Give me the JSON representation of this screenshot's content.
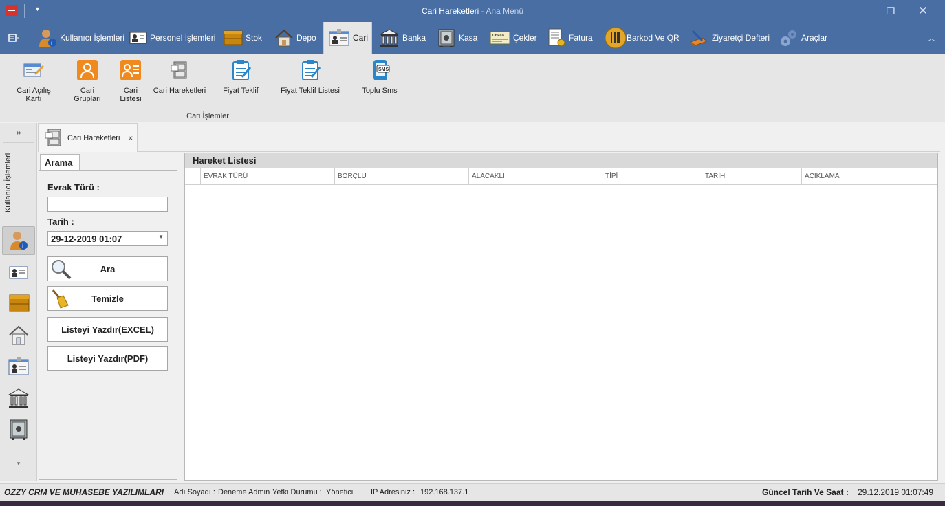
{
  "window": {
    "title": "Cari Hareketleri",
    "title_suffix": " - Ana Menü",
    "controls": [
      "minimize",
      "restore",
      "close"
    ]
  },
  "ribbon_tabs": [
    {
      "label": "Kullanıcı İşlemleri",
      "icon": "user-info-icon"
    },
    {
      "label": "Personel İşlemleri",
      "icon": "id-card-icon"
    },
    {
      "label": "Stok",
      "icon": "stock-box-icon"
    },
    {
      "label": "Depo",
      "icon": "house-icon"
    },
    {
      "label": "Cari",
      "icon": "cari-card-icon",
      "active": true
    },
    {
      "label": "Banka",
      "icon": "bank-icon"
    },
    {
      "label": "Kasa",
      "icon": "safe-icon"
    },
    {
      "label": "Çekler",
      "icon": "check-icon"
    },
    {
      "label": "Fatura",
      "icon": "invoice-icon"
    },
    {
      "label": "Barkod Ve QR",
      "icon": "barcode-icon"
    },
    {
      "label": "Ziyaretçi Defteri",
      "icon": "guestbook-icon"
    },
    {
      "label": "Araçlar",
      "icon": "gears-icon"
    }
  ],
  "ribbon_buttons": [
    {
      "label": "Cari Açılış Kartı",
      "icon": "card-edit-icon"
    },
    {
      "label": "Cari Grupları",
      "icon": "user-group-icon"
    },
    {
      "label": "Cari Listesi",
      "icon": "user-list-icon"
    },
    {
      "label": "Cari Hareketleri",
      "icon": "cabinet-icon"
    },
    {
      "label": "Fiyat Teklif",
      "icon": "clipboard-edit-icon"
    },
    {
      "label": "Fiyat Teklif Listesi",
      "icon": "clipboard-list-icon"
    },
    {
      "label": "Toplu Sms",
      "icon": "sms-phone-icon"
    }
  ],
  "ribbon_group_label": "Cari İşlemler",
  "leftnav": {
    "label": "Kullanıcı İşlemleri",
    "expand": "»",
    "more": "▾"
  },
  "document_tab": {
    "label": "Cari Hareketleri",
    "close": "×"
  },
  "search": {
    "tab_label": "Arama",
    "evrak_turu_label": "Evrak Türü :",
    "evrak_turu_value": "",
    "tarih_label": "Tarih :",
    "tarih_value": "29-12-2019 01:07",
    "buttons": {
      "ara": "Ara",
      "temizle": "Temizle",
      "excel": "Listeyi Yazdır(EXCEL)",
      "pdf": "Listeyi Yazdır(PDF)"
    }
  },
  "grid": {
    "title": "Hareket Listesi",
    "columns": [
      "EVRAK TÜRÜ",
      "BORÇLU",
      "ALACAKLI",
      "TİPİ",
      "TARİH",
      "AÇIKLAMA"
    ],
    "rows": []
  },
  "statusbar": {
    "brand": "OZZY CRM VE MUHASEBE YAZILIMLARI",
    "name_label": "Adı Soyadı :",
    "name_value": "Deneme Admin",
    "role_label": "Yetki Durumu :",
    "role_value": "Yönetici",
    "ip_label": "IP Adresiniz :",
    "ip_value": "192.168.137.1",
    "datetime_label": "Güncel Tarih Ve Saat :",
    "datetime_value": "29.12.2019 01:07:49"
  }
}
